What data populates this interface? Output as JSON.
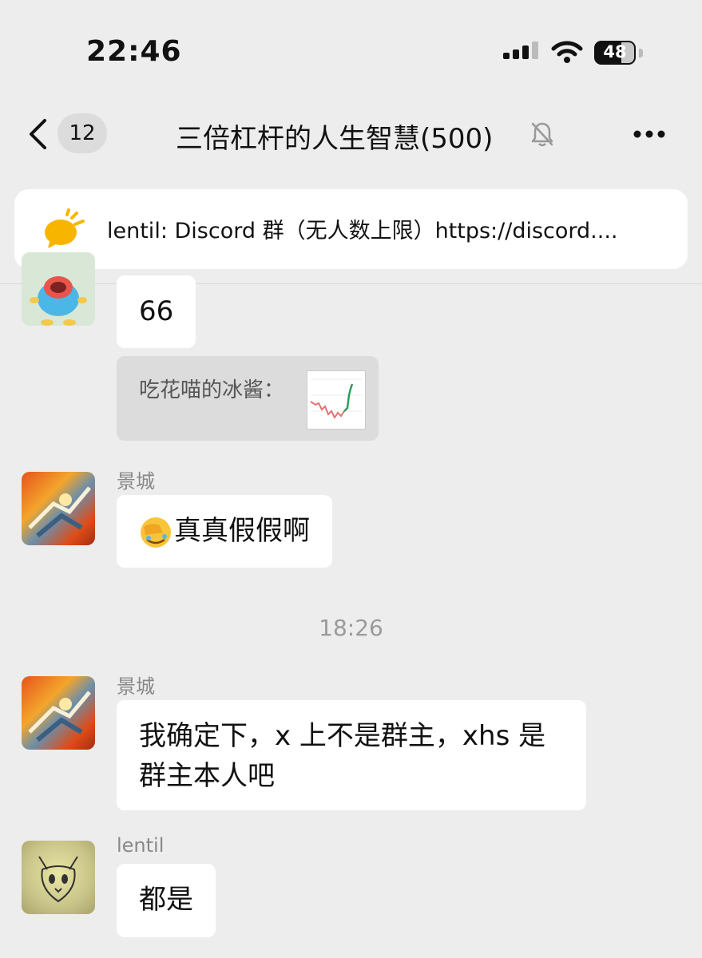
{
  "status_bar": {
    "time": "22:46",
    "battery": "48"
  },
  "nav": {
    "unread_count": "12",
    "title": "三倍杠杆的人生智慧(500)"
  },
  "pinned": {
    "text": "lentil: Discord 群（无人数上限）https://discord...."
  },
  "messages": [
    {
      "text": "66"
    },
    {
      "quote_text": "吃花喵的冰酱："
    },
    {
      "sender": "景城",
      "text": "真真假假啊"
    },
    {
      "timestamp": "18:26"
    },
    {
      "sender": "景城",
      "line1": "我确定下，x 上不是群主，xhs 是",
      "line2": "群主本人吧"
    },
    {
      "sender": "lentil",
      "text": "都是"
    }
  ],
  "icons": {
    "back": "chevron-left-icon",
    "mute": "bell-slash-icon",
    "more": "more-dots-icon",
    "pin": "speech-bubble-icon"
  },
  "colors": {
    "background": "#ededed",
    "bubble": "#ffffff",
    "pin_icon": "#f7b500"
  }
}
